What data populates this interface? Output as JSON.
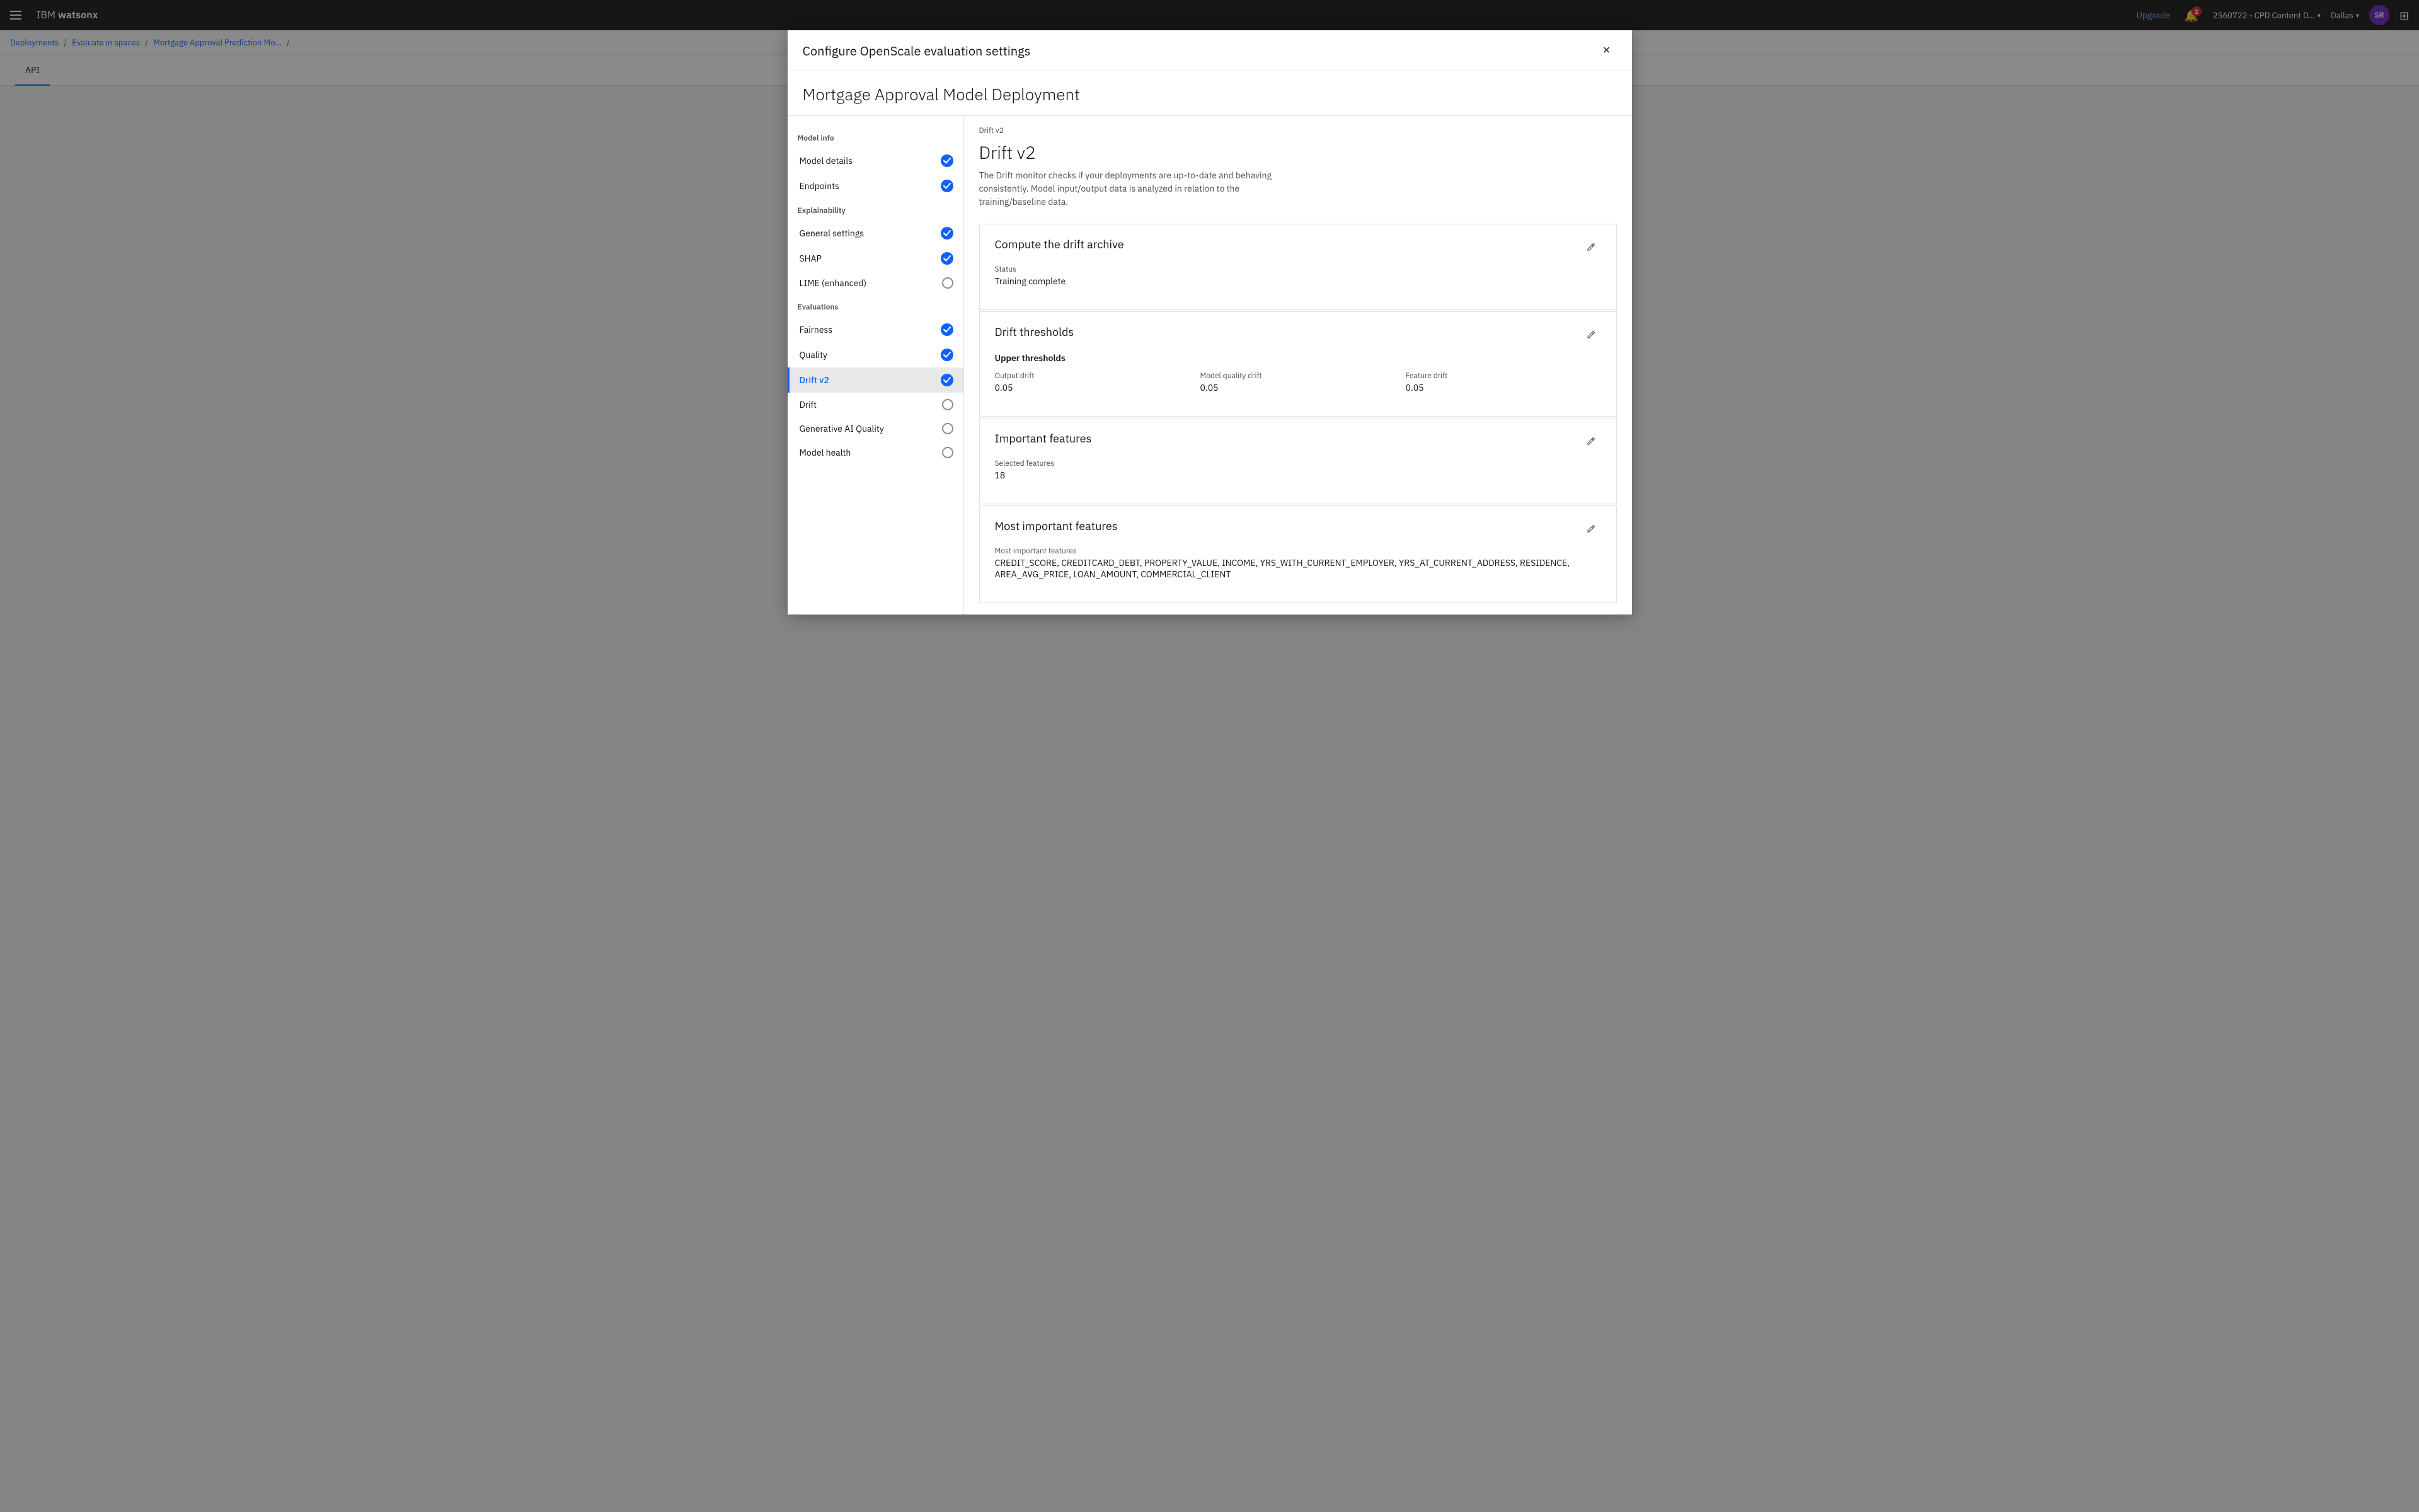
{
  "navbar": {
    "menu_icon_label": "Menu",
    "brand": "IBM watsonx",
    "upgrade_label": "Upgrade",
    "notification_count": "2",
    "account_name": "2560722 - CPD Content D...",
    "location": "Dallas",
    "avatar_initials": "SR",
    "grid_icon_label": "Grid"
  },
  "breadcrumb": {
    "items": [
      "Deployments",
      "Evaluate in spaces",
      "Mortgage Approval Prediction Mo...",
      ""
    ]
  },
  "main_tab": {
    "label": "API"
  },
  "modal": {
    "title": "Configure OpenScale evaluation settings",
    "close_label": "×",
    "deployment_title": "Mortgage Approval Model Deployment"
  },
  "sidebar": {
    "sections": [
      {
        "label": "Model info",
        "items": [
          {
            "id": "model-details",
            "label": "Model details",
            "checked": true,
            "active": false
          },
          {
            "id": "endpoints",
            "label": "Endpoints",
            "checked": true,
            "active": false
          }
        ]
      },
      {
        "label": "Explainability",
        "items": [
          {
            "id": "general-settings",
            "label": "General settings",
            "checked": true,
            "active": false
          },
          {
            "id": "shap",
            "label": "SHAP",
            "checked": true,
            "active": false
          },
          {
            "id": "lime-enhanced",
            "label": "LIME (enhanced)",
            "checked": false,
            "active": false
          }
        ]
      },
      {
        "label": "Evaluations",
        "items": [
          {
            "id": "fairness",
            "label": "Fairness",
            "checked": true,
            "active": false
          },
          {
            "id": "quality",
            "label": "Quality",
            "checked": true,
            "active": false
          },
          {
            "id": "drift-v2",
            "label": "Drift v2",
            "checked": true,
            "active": true
          },
          {
            "id": "drift",
            "label": "Drift",
            "checked": false,
            "active": false
          },
          {
            "id": "generative-ai-quality",
            "label": "Generative AI Quality",
            "checked": false,
            "active": false
          },
          {
            "id": "model-health",
            "label": "Model health",
            "checked": false,
            "active": false
          }
        ]
      }
    ]
  },
  "content": {
    "breadcrumb": "Drift v2",
    "title": "Drift v2",
    "description": "The Drift monitor checks if your deployments are up-to-date and behaving consistently. Model input/output data is analyzed in relation to the training/baseline data."
  },
  "cards": {
    "compute_drift_archive": {
      "title": "Compute the drift archive",
      "edit_label": "Edit",
      "status_label": "Status",
      "status_value": "Training complete"
    },
    "drift_thresholds": {
      "title": "Drift thresholds",
      "edit_label": "Edit",
      "subsection_title": "Upper thresholds",
      "output_drift_label": "Output drift",
      "output_drift_value": "0.05",
      "model_quality_drift_label": "Model quality drift",
      "model_quality_drift_value": "0.05",
      "feature_drift_label": "Feature drift",
      "feature_drift_value": "0.05"
    },
    "important_features": {
      "title": "Important features",
      "edit_label": "Edit",
      "selected_features_label": "Selected features",
      "selected_features_value": "18"
    },
    "most_important_features": {
      "title": "Most important features",
      "edit_label": "Edit",
      "label": "Most important features",
      "value": "CREDIT_SCORE, CREDITCARD_DEBT, PROPERTY_VALUE, INCOME, YRS_WITH_CURRENT_EMPLOYER, YRS_AT_CURRENT_ADDRESS, RESIDENCE, AREA_AVG_PRICE, LOAN_AMOUNT, COMMERCIAL_CLIENT"
    }
  }
}
